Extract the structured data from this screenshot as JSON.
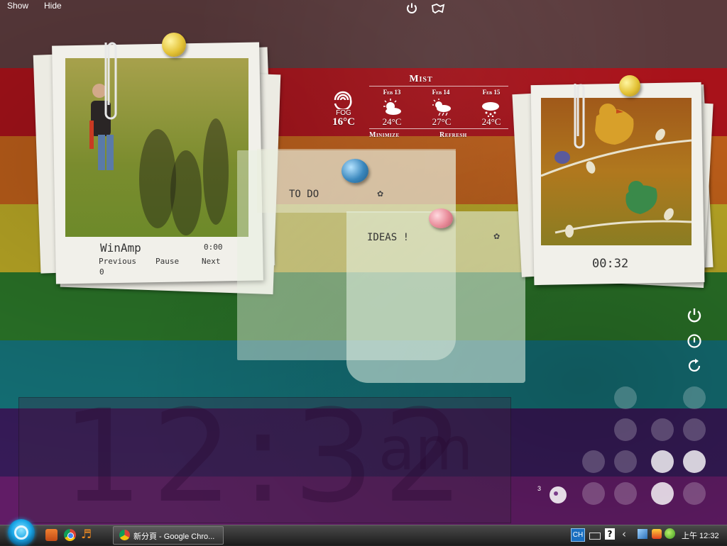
{
  "desktop": {
    "colors": {
      "stripe_red": "#b8141c",
      "stripe_orange": "#c8641a",
      "stripe_yellow": "#c9b62a",
      "stripe_green": "#2e7a2c",
      "stripe_teal": "#16757a",
      "stripe_purple": "#3a1e5e",
      "stripe_magenta": "#6a1f6e"
    }
  },
  "top_menu": {
    "show": "Show",
    "hide": "Hide"
  },
  "top_icons": [
    "power-icon",
    "map-icon"
  ],
  "weather": {
    "location": "Mist",
    "current": {
      "condition": "FOG",
      "temp": "16°C"
    },
    "forecast": [
      {
        "date": "Feb 13",
        "temp": "24°C",
        "icon": "partly-sunny-icon"
      },
      {
        "date": "Feb 14",
        "temp": "27°C",
        "icon": "sun-rain-icon"
      },
      {
        "date": "Feb 15",
        "temp": "24°C",
        "icon": "snow-cloud-icon"
      }
    ],
    "minimize": "Minimize",
    "refresh": "Refresh"
  },
  "winamp": {
    "title": "WinAmp",
    "time": "0:00",
    "previous": "Previous",
    "pause": "Pause",
    "next": "Next",
    "track_number": "0"
  },
  "notes": {
    "todo": {
      "title": "TO DO",
      "icon": "flower-icon"
    },
    "ideas": {
      "title": "IDEAS !",
      "icon": "flower-icon"
    }
  },
  "bird_photo": {
    "timer": "00:32"
  },
  "clock": {
    "time": "12:32",
    "ampm": "am"
  },
  "side_controls": [
    "power-icon",
    "info-icon",
    "refresh-icon"
  ],
  "launcher": {
    "badge": "3"
  },
  "taskbar": {
    "window_title": "新分頁 - Google Chro...",
    "lang": "CH",
    "clock": "上午 12:32",
    "colors": {
      "accent": "#1aa7e8"
    }
  }
}
